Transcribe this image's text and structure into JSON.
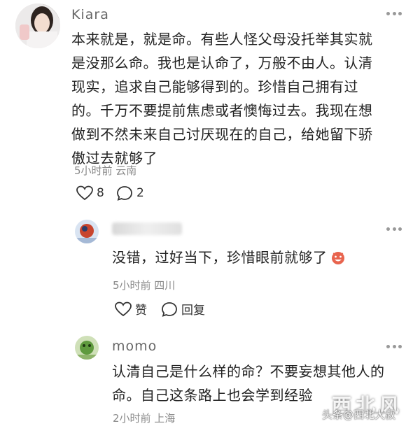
{
  "comment_main": {
    "username": "Kiara",
    "lines": [
      "本来就是，就是命。有些人怪父母没托举其实就",
      "是没那么命。我也是认命了，万般不由人。认清",
      "现实，追求自己能够得到的。珍惜自己拥有过",
      "的。千万不要提前焦虑或者懊悔过去。我现在想",
      "做到不然未来自己讨厌现在的自己，给她留下骄",
      "傲过去就够了"
    ],
    "meta": "5小时前 云南",
    "likes": "8",
    "replies": "2"
  },
  "reply_1": {
    "username": "",
    "text": "没错，过好当下，珍惜眼前就够了",
    "meta": "5小时前 四川",
    "like_label": "赞",
    "reply_label": "回复"
  },
  "reply_2": {
    "username": "momo",
    "lines": [
      "认清自己是什么样的命？不要妄想其他人的",
      "命。自己这条路上也会学到经验"
    ],
    "meta": "2小时前 上海"
  },
  "watermark": {
    "text": "头条@西北大叔",
    "overlay": "西北风"
  },
  "colors": {
    "text": "#222222",
    "meta": "#8a8a8a",
    "username": "#666666"
  }
}
